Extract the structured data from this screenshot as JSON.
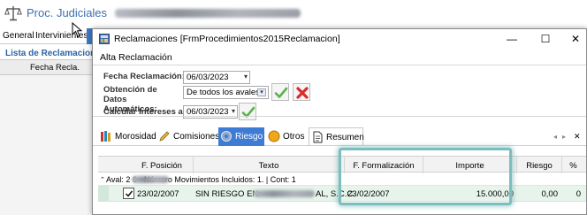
{
  "background_window": {
    "title": "Proc. Judiciales",
    "tabs": [
      "General",
      "Intervinientes"
    ],
    "sidebar_title": "Lista de Reclamaciones",
    "grid_header": "Fecha Recla."
  },
  "dialog": {
    "title": "Reclamaciones [FrmProcedimientos2015Reclamacion]",
    "window_buttons": {
      "minimize": "—",
      "maximize": "☐",
      "close": "✕"
    },
    "section_title": "Alta Reclamación",
    "form": {
      "fecha_label": "Fecha Reclamación:",
      "fecha_value": "06/03/2023",
      "obtencion_label": "Obtención de Datos Automáticos:",
      "obtencion_value": "De todos los avales",
      "calcular_label": "Calcular Intereses a:",
      "calcular_value": "06/03/2023"
    },
    "tabs": [
      {
        "label": "Morosidad",
        "icon": "books-icon",
        "active": false
      },
      {
        "label": "Comisiones",
        "icon": "pencil-icon",
        "active": false
      },
      {
        "label": "Riesgo",
        "icon": "gear-icon",
        "active": true
      },
      {
        "label": "Otros",
        "icon": "coin-icon",
        "active": false
      },
      {
        "label": "Resumen",
        "icon": "document-icon",
        "active": false
      }
    ],
    "tab_nav": {
      "prev": "◂",
      "next": "▸",
      "close": "✕"
    },
    "grid": {
      "columns": [
        "F. Posición",
        "Texto",
        "F. Formalización",
        "Importe",
        "Riesgo",
        "%"
      ],
      "group_row": "Aval: 2                6 - Número Movimientos Incluidos: 1. | Cont: 1",
      "rows": [
        {
          "checked": true,
          "f_posicion": "23/02/2007",
          "texto_prefix": "SIN RIESGO EN:",
          "texto_suffix": "AL, S.C.C.",
          "f_formalizacion": "23/02/2007",
          "importe": "15.000,00",
          "riesgo": "0,00",
          "pct": "0"
        }
      ]
    }
  },
  "colors": {
    "accent": "#3e7bd4",
    "title_blue": "#3c6fb0",
    "row_selected": "#e7f4ec",
    "highlight": "#7dbdbd",
    "check_green": "#58b34a",
    "cancel_red": "#d92b2b"
  }
}
